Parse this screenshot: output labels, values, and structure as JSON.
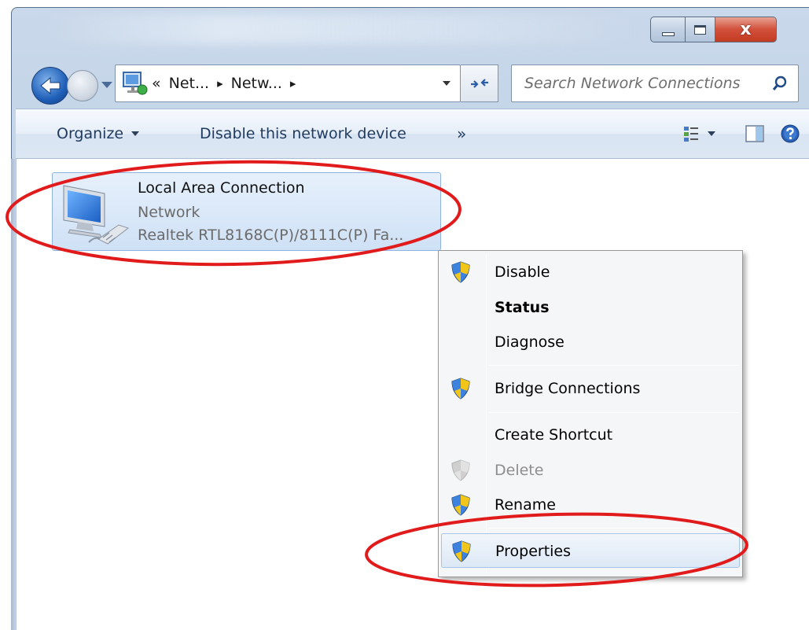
{
  "window": {
    "caption_min_icon": "minimize-icon",
    "caption_max_icon": "maximize-icon",
    "caption_close_glyph": "x"
  },
  "nav": {
    "address_parts": [
      "«",
      "Net...",
      "▸",
      "Netw...",
      "▸"
    ],
    "search_placeholder": "Search Network Connections"
  },
  "toolbar": {
    "organize_label": "Organize",
    "disable_label": "Disable this network device",
    "more_label": "»"
  },
  "connection": {
    "name": "Local Area Connection",
    "type": "Network",
    "adapter": "Realtek RTL8168C(P)/8111C(P) Fa..."
  },
  "context_menu": {
    "items": [
      {
        "label": "Disable",
        "shield": true
      },
      {
        "label": "Status",
        "bold": true
      },
      {
        "label": "Diagnose"
      },
      {
        "label": "Bridge Connections",
        "shield": true
      },
      {
        "label": "Create Shortcut"
      },
      {
        "label": "Delete",
        "shield": true,
        "disabled": true
      },
      {
        "label": "Rename",
        "shield": true
      },
      {
        "label": "Properties",
        "shield": true,
        "highlighted": true
      }
    ]
  },
  "colors": {
    "annotation": "#e11b1b",
    "accent": "#1f5fb8"
  }
}
